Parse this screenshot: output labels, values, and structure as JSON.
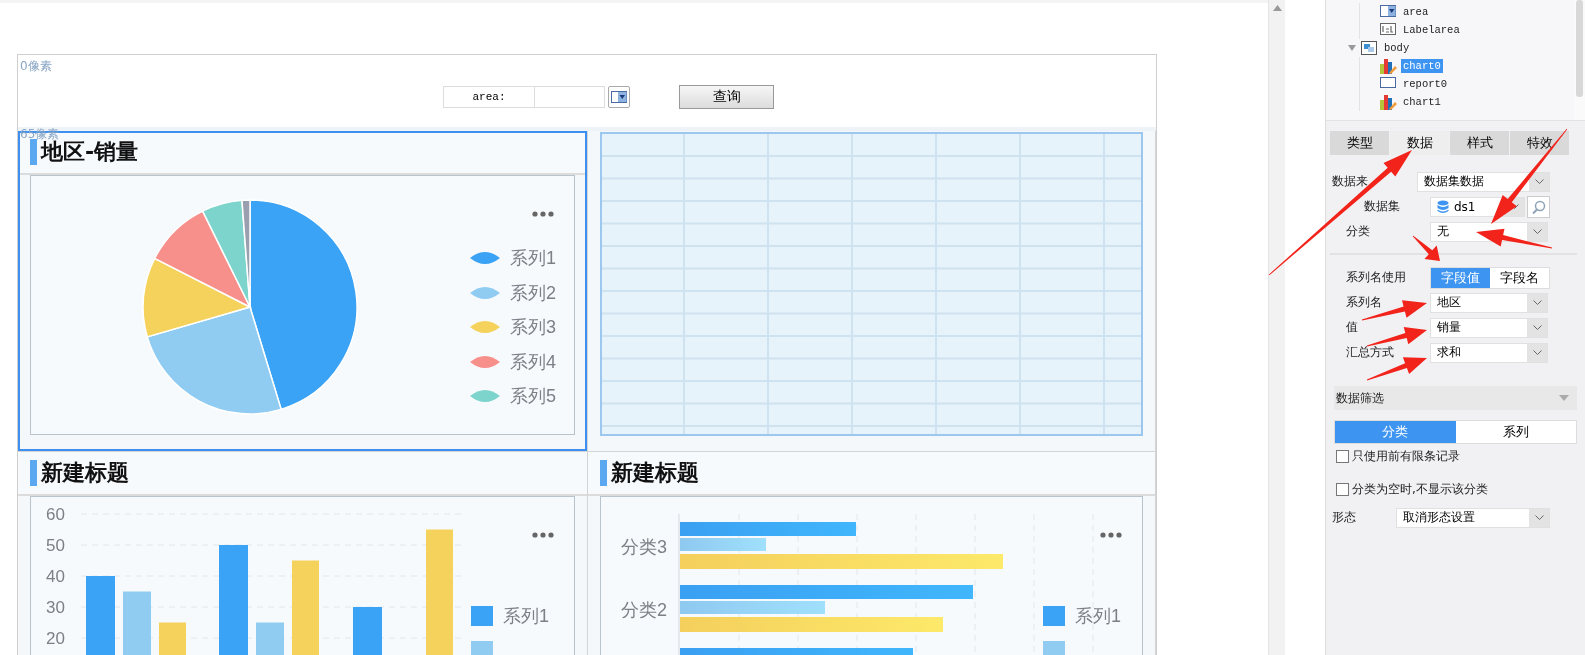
{
  "canvas": {
    "top_ruler_label": "0像素",
    "body_ruler_label": "65像素"
  },
  "parameter_pane": {
    "label": "area:",
    "button": "查询"
  },
  "cells": [
    {
      "kind": "pie",
      "title": "地区-销量",
      "selected": true,
      "legend": [
        {
          "name": "系列1",
          "color": "#3ba3f5"
        },
        {
          "name": "系列2",
          "color": "#90cbf2"
        },
        {
          "name": "系列3",
          "color": "#f5d25c"
        },
        {
          "name": "系列4",
          "color": "#f78f8a"
        },
        {
          "name": "系列5",
          "color": "#7dd4cc"
        }
      ]
    },
    {
      "kind": "report",
      "selected": false
    },
    {
      "kind": "column",
      "title": "新建标题",
      "selected": false,
      "chart_data": {
        "type": "bar",
        "ylim": [
          0,
          60
        ],
        "grid": true,
        "yticks": [
          20,
          30,
          40,
          50,
          60
        ],
        "series": [
          {
            "name": "系列1",
            "color": "#3ba3f5",
            "values": [
              40,
              50,
              30
            ]
          },
          {
            "color": "#90cbf2",
            "values": [
              35,
              25,
              null
            ]
          },
          {
            "color": "#f5d25c",
            "values": [
              25,
              45,
              55
            ]
          }
        ]
      }
    },
    {
      "kind": "bar",
      "title": "新建标题",
      "selected": false,
      "categories": [
        "分类3",
        "分类2"
      ],
      "legend": [
        {
          "name": "系列1",
          "color": "#3ba3f5"
        },
        {
          "color": "#90cbf2"
        }
      ]
    }
  ],
  "tree": [
    {
      "children": [
        {
          "label": "area",
          "kind": "combo",
          "selected": false
        },
        {
          "label": "Labelarea",
          "kind": "label",
          "selected": false
        }
      ]
    },
    {
      "label": "body",
      "kind": "layout",
      "selected": false,
      "expanded": true,
      "children": [
        {
          "label": "chart0",
          "kind": "chart",
          "selected": true
        },
        {
          "label": "report0",
          "kind": "report",
          "selected": false
        },
        {
          "label": "chart1",
          "kind": "chart",
          "selected": false
        }
      ]
    }
  ],
  "tabs": [
    {
      "label": "类型",
      "selected": false
    },
    {
      "label": "数据",
      "selected": true
    },
    {
      "label": "样式",
      "selected": false
    },
    {
      "label": "特效",
      "selected": false
    }
  ],
  "fields": [
    {
      "kind": "select",
      "label": "数据来",
      "value": "数据集数据"
    },
    {
      "kind": "dataset",
      "label": "数据集",
      "value": "ds1"
    },
    {
      "kind": "select",
      "label": "分类",
      "value": "无"
    }
  ],
  "series_name_mode": {
    "label": "系列名使用",
    "options": [
      {
        "label": "字段值",
        "selected": true
      },
      {
        "label": "字段名",
        "selected": false
      }
    ]
  },
  "series_fields": [
    {
      "label": "系列名",
      "value": "地区"
    },
    {
      "label": "值",
      "value": "销量"
    },
    {
      "label": "汇总方式",
      "value": "求和"
    }
  ],
  "filter": {
    "title": "数据筛选",
    "expanded": true,
    "tabs": [
      {
        "label": "分类",
        "selected": true
      },
      {
        "label": "系列",
        "selected": false
      }
    ],
    "checkboxes": [
      {
        "label": "只使用前有限条记录",
        "checked": false
      },
      {
        "label": "分类为空时,不显示该分类",
        "checked": false
      }
    ]
  },
  "shape": {
    "label": "形态",
    "value": "取消形态设置"
  }
}
